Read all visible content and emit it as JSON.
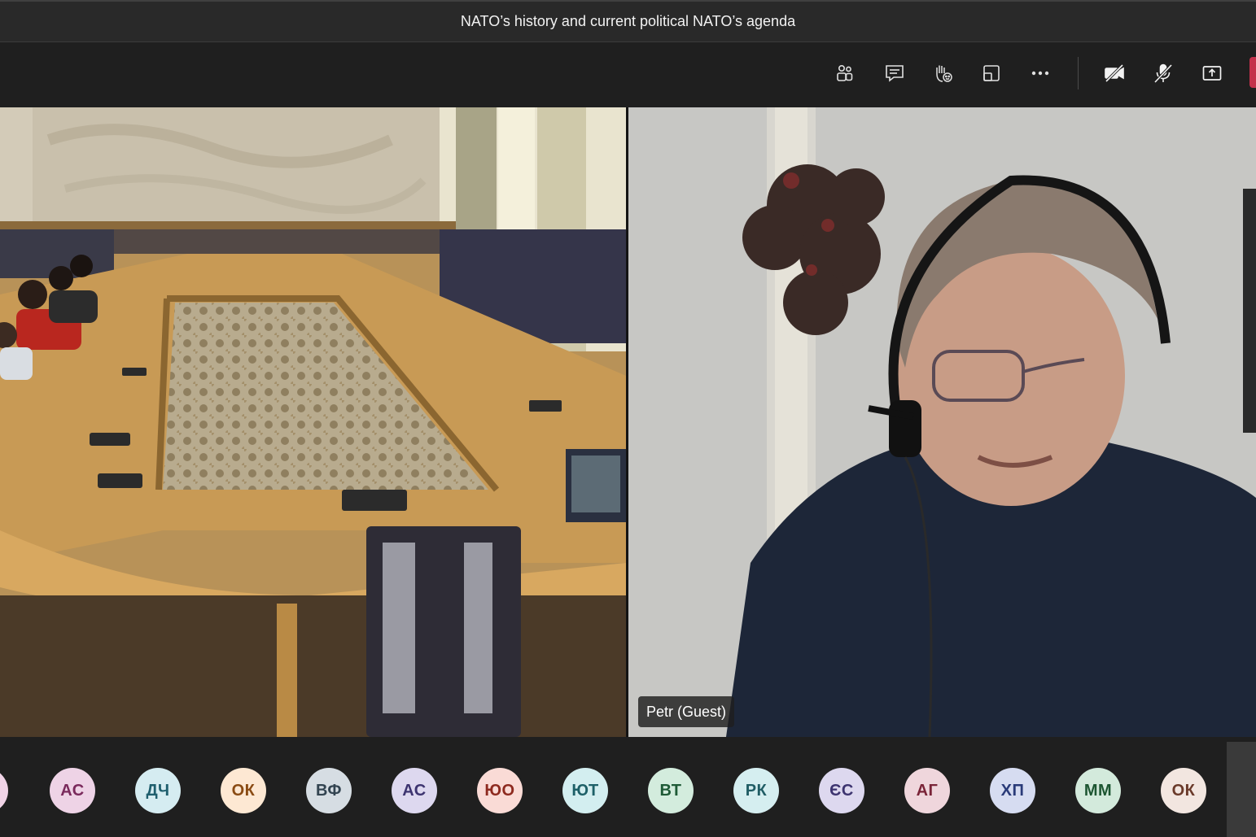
{
  "meeting": {
    "title": "NATO’s history and current political NATO’s agenda"
  },
  "toolbar": {
    "buttons": [
      {
        "name": "people",
        "icon": "people-icon"
      },
      {
        "name": "chat",
        "icon": "chat-icon"
      },
      {
        "name": "reactions",
        "icon": "raise-hand-icon"
      },
      {
        "name": "rooms",
        "icon": "rooms-icon"
      },
      {
        "name": "more",
        "icon": "more-icon"
      },
      {
        "name": "camera",
        "icon": "camera-off-icon"
      },
      {
        "name": "mic",
        "icon": "mic-off-icon"
      },
      {
        "name": "share",
        "icon": "share-tray-icon"
      }
    ],
    "leave_color": "#c4314b"
  },
  "stage": {
    "participants": [
      {
        "label": "",
        "description": "conference room video"
      },
      {
        "label": "Petr (Guest)"
      }
    ]
  },
  "roster": {
    "avatars": [
      {
        "initials": "",
        "bg": "#f0d3e6",
        "fg": "#7a2a5c"
      },
      {
        "initials": "АС",
        "bg": "#eed3e6",
        "fg": "#7a2a5c"
      },
      {
        "initials": "ДЧ",
        "bg": "#d5ecf1",
        "fg": "#1f5f6e"
      },
      {
        "initials": "ОК",
        "bg": "#fde8d3",
        "fg": "#8a4b13"
      },
      {
        "initials": "ВФ",
        "bg": "#d6dde3",
        "fg": "#334451"
      },
      {
        "initials": "АС",
        "bg": "#ddd8ef",
        "fg": "#3d3470"
      },
      {
        "initials": "ЮО",
        "bg": "#fadbd6",
        "fg": "#8e2a1f"
      },
      {
        "initials": "ЮТ",
        "bg": "#d3eef0",
        "fg": "#1d6068"
      },
      {
        "initials": "ВТ",
        "bg": "#d3ecdd",
        "fg": "#1e5a36"
      },
      {
        "initials": "РК",
        "bg": "#d5eef0",
        "fg": "#205d65"
      },
      {
        "initials": "ЄС",
        "bg": "#ddd8ef",
        "fg": "#3d3470"
      },
      {
        "initials": "АГ",
        "bg": "#efd6dc",
        "fg": "#7a2438"
      },
      {
        "initials": "ХП",
        "bg": "#d6dcf1",
        "fg": "#2a3b79"
      },
      {
        "initials": "ММ",
        "bg": "#d3eadc",
        "fg": "#1d5632"
      },
      {
        "initials": "ОК",
        "bg": "#f2e6e0",
        "fg": "#6a3a2a"
      }
    ]
  }
}
